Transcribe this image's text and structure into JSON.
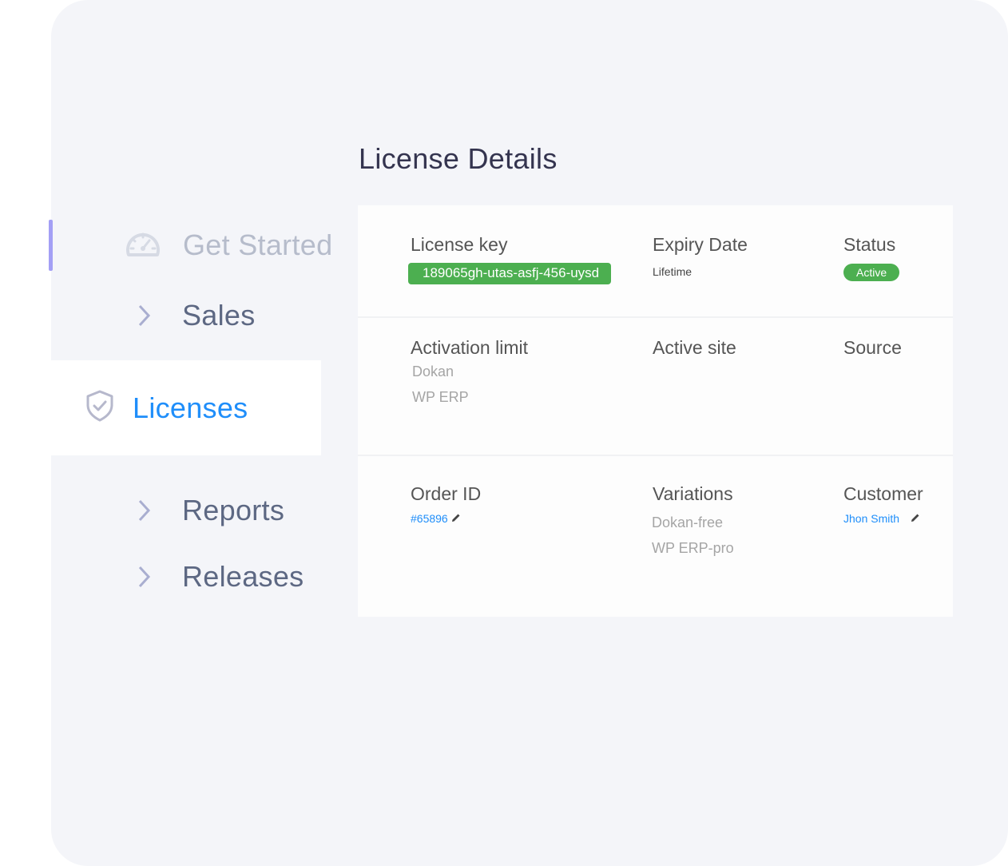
{
  "sidebar": {
    "items": [
      {
        "label": "Get Started",
        "icon": "speedometer-icon",
        "active_indicator": true
      },
      {
        "label": "Sales",
        "icon": "chevron-right-icon"
      },
      {
        "label": "Licenses",
        "icon": "shield-check-icon",
        "selected": true
      },
      {
        "label": "Reports",
        "icon": "chevron-right-icon"
      },
      {
        "label": "Releases",
        "icon": "chevron-right-icon"
      }
    ]
  },
  "main": {
    "title": "License Details",
    "license_key": {
      "label": "License key",
      "value": "189065gh-utas-asfj-456-uysd"
    },
    "expiry_date": {
      "label": "Expiry Date",
      "value": "Lifetime"
    },
    "status": {
      "label": "Status",
      "value": "Active"
    },
    "activation_limit": {
      "label": "Activation limit",
      "values": [
        "Dokan",
        "WP ERP"
      ]
    },
    "active_site": {
      "label": "Active site"
    },
    "source": {
      "label": "Source"
    },
    "order_id": {
      "label": "Order ID",
      "value": "#65896",
      "icon": "pencil-icon"
    },
    "variations": {
      "label": "Variations",
      "values": [
        "Dokan-free",
        "WP ERP-pro"
      ]
    },
    "customer": {
      "label": "Customer",
      "value": "Jhon Smith",
      "icon": "pencil-icon"
    }
  },
  "colors": {
    "accent": "#1f8efa",
    "success": "#4caf50",
    "active_indicator": "#a39ff5",
    "panel_bg": "#f4f5f9"
  }
}
